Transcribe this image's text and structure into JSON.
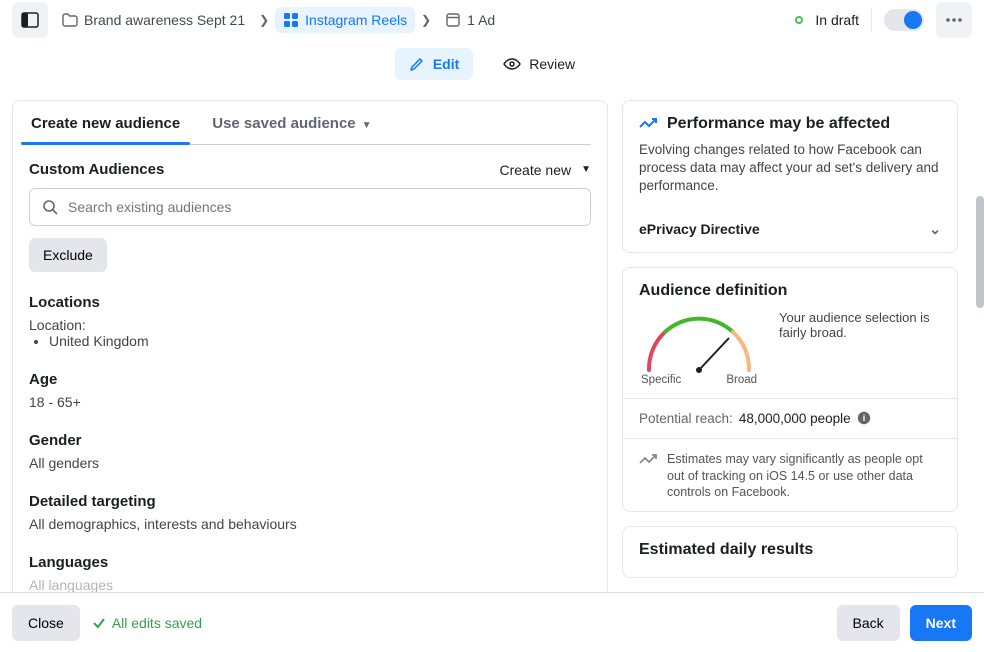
{
  "breadcrumb": {
    "campaign": "Brand awareness Sept 21",
    "adset": "Instagram Reels",
    "ad": "1 Ad"
  },
  "status": "In draft",
  "mode": {
    "edit": "Edit",
    "review": "Review"
  },
  "tabs": {
    "create": "Create new audience",
    "saved": "Use saved audience"
  },
  "custom_audiences": {
    "title": "Custom Audiences",
    "create_new": "Create new",
    "search_placeholder": "Search existing audiences",
    "exclude": "Exclude"
  },
  "locations": {
    "title": "Locations",
    "label": "Location:",
    "items": [
      "United Kingdom"
    ]
  },
  "age": {
    "title": "Age",
    "value": "18 - 65+"
  },
  "gender": {
    "title": "Gender",
    "value": "All genders"
  },
  "detailed": {
    "title": "Detailed targeting",
    "value": "All demographics, interests and behaviours"
  },
  "languages": {
    "title": "Languages",
    "value": "All languages"
  },
  "performance": {
    "title": "Performance may be affected",
    "body": "Evolving changes related to how Facebook can process data may affect your ad set's delivery and performance.",
    "eprivacy": "ePrivacy Directive"
  },
  "audience_def": {
    "title": "Audience definition",
    "specific": "Specific",
    "broad": "Broad",
    "msg": "Your audience selection is fairly broad.",
    "reach_label": "Potential reach:",
    "reach_value": "48,000,000 people",
    "note": "Estimates may vary significantly as people opt out of tracking on iOS 14.5 or use other data controls on Facebook."
  },
  "edr": {
    "title": "Estimated daily results"
  },
  "footer": {
    "close": "Close",
    "saved": "All edits saved",
    "back": "Back",
    "next": "Next"
  }
}
